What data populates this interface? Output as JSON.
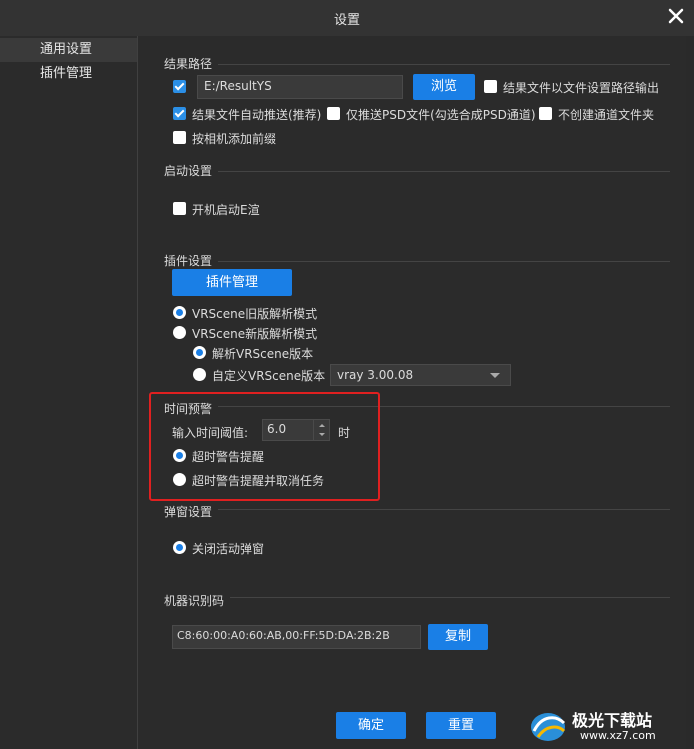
{
  "window": {
    "title": "设置"
  },
  "sidebar": {
    "items": [
      {
        "label": "通用设置"
      },
      {
        "label": "插件管理"
      }
    ]
  },
  "result_path": {
    "section_title": "结果路径",
    "path_value": "E:/ResultYS",
    "browse_label": "浏览",
    "follow_file_path_label": "结果文件以文件设置路径输出",
    "auto_push_label": "结果文件自动推送(推荐)",
    "psd_only_label": "仅推送PSD文件(勾选合成PSD通道)",
    "no_channel_folder_label": "不创建通道文件夹",
    "camera_prefix_label": "按相机添加前缀"
  },
  "startup": {
    "section_title": "启动设置",
    "auto_start_label": "开机启动E渲"
  },
  "plugin": {
    "section_title": "插件设置",
    "manage_label": "插件管理",
    "old_mode_label": "VRScene旧版解析模式",
    "new_mode_label": "VRScene新版解析模式",
    "parse_version_label": "解析VRScene版本",
    "custom_version_label": "自定义VRScene版本",
    "version_value": "vray 3.00.08"
  },
  "time_warning": {
    "section_title": "时间预警",
    "threshold_label": "输入时间阈值:",
    "threshold_value": "6.0",
    "unit": "时",
    "warn_label": "超时警告提醒",
    "warn_cancel_label": "超时警告提醒并取消任务"
  },
  "popup": {
    "section_title": "弹窗设置",
    "close_popup_label": "关闭活动弹窗"
  },
  "machine": {
    "section_title": "机器识别码",
    "code_value": "C8:60:00:A0:60:AB,00:FF:5D:DA:2B:2B",
    "copy_label": "复制"
  },
  "footer": {
    "ok_label": "确定",
    "reset_label": "重置"
  },
  "watermark": {
    "line1": "极光下载站",
    "line2": "www.xz7.com"
  },
  "colors": {
    "accent": "#1a7fe6",
    "highlight": "#e02020"
  }
}
